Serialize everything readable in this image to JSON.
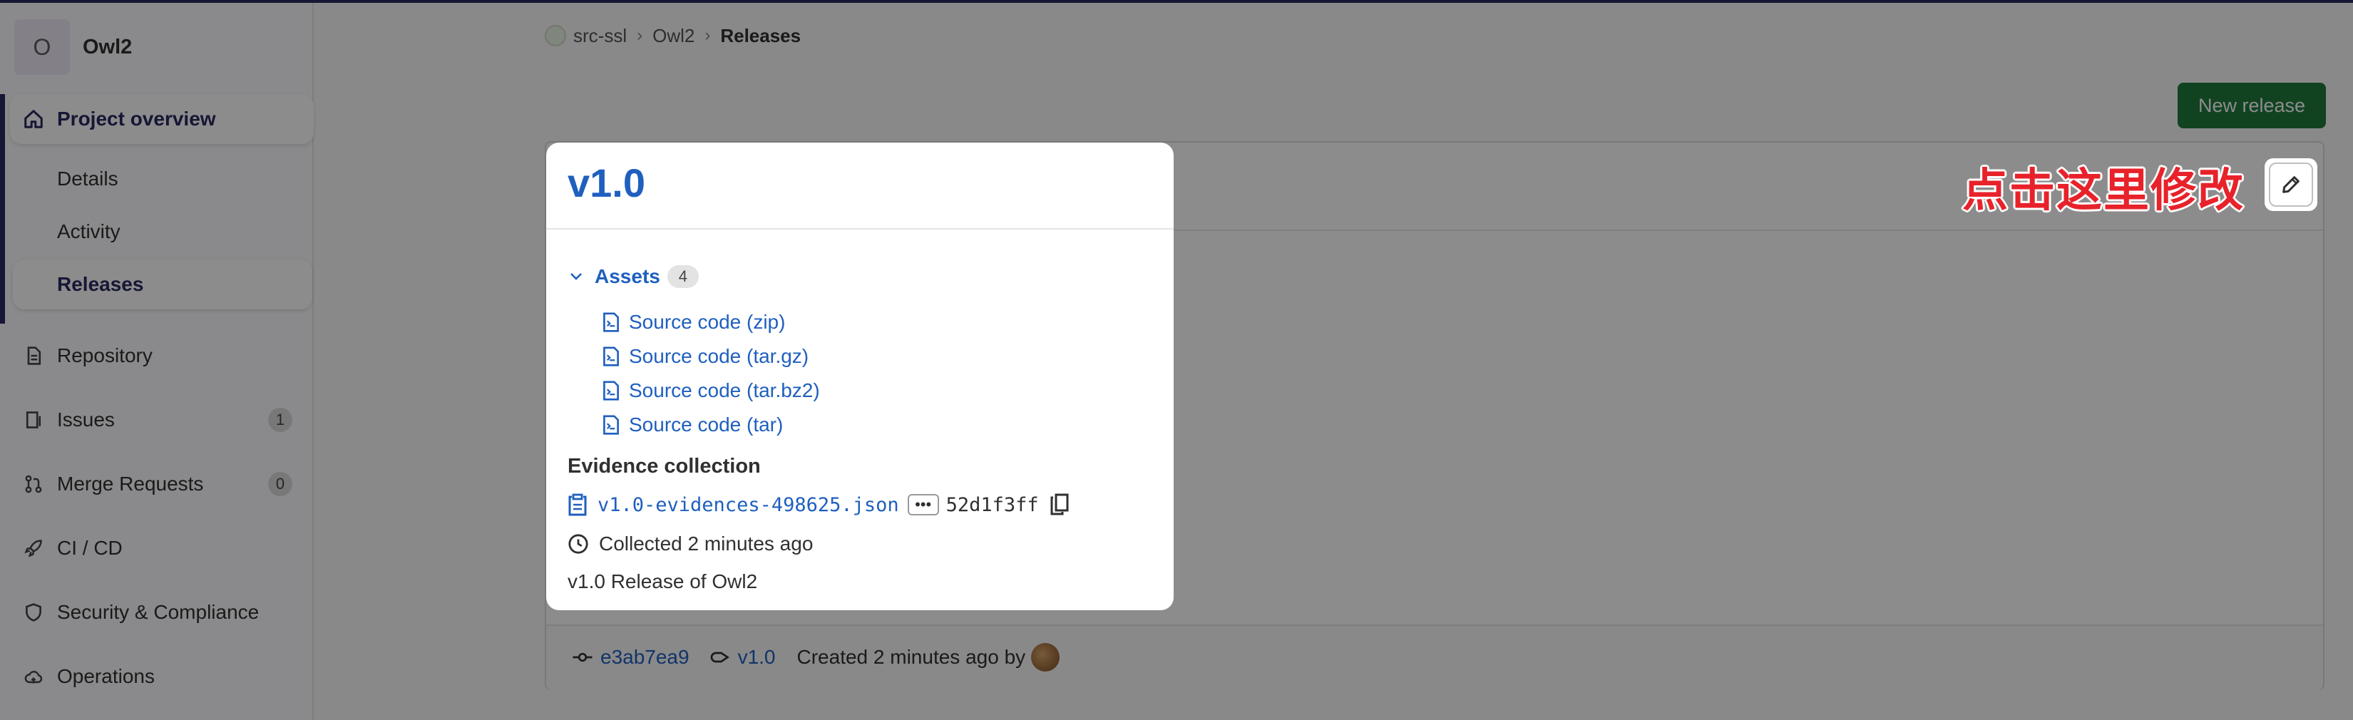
{
  "project": {
    "initial": "O",
    "name": "Owl2"
  },
  "sidebar": {
    "overview": {
      "label": "Project overview",
      "sub": [
        "Details",
        "Activity",
        "Releases"
      ]
    },
    "items": [
      {
        "label": "Repository",
        "count": ""
      },
      {
        "label": "Issues",
        "count": "1"
      },
      {
        "label": "Merge Requests",
        "count": "0"
      },
      {
        "label": "CI / CD",
        "count": ""
      },
      {
        "label": "Security & Compliance",
        "count": ""
      },
      {
        "label": "Operations",
        "count": ""
      }
    ]
  },
  "breadcrumb": {
    "group": "src-ssl",
    "project": "Owl2",
    "current": "Releases",
    "separator": "›"
  },
  "actions": {
    "new_release": "New release"
  },
  "release": {
    "tag": "v1.0",
    "assets_label": "Assets",
    "assets_count": "4",
    "assets": [
      "Source code (zip)",
      "Source code (tar.gz)",
      "Source code (tar.bz2)",
      "Source code (tar)"
    ],
    "evidence_title": "Evidence collection",
    "evidence_file": "v1.0-evidences-498625.json",
    "evidence_more": "•••",
    "evidence_hash": "52d1f3ff",
    "collected": "Collected 2 minutes ago",
    "description": "v1.0 Release of Owl2",
    "commit": "e3ab7ea9",
    "tag_link": "v1.0",
    "created": "Created 2 minutes ago by"
  },
  "annotation": {
    "text": "点击这里修改"
  },
  "colors": {
    "accent": "#292961",
    "link": "#1f5fbf",
    "success": "#1f7a3d",
    "annotation": "#e8222a"
  }
}
